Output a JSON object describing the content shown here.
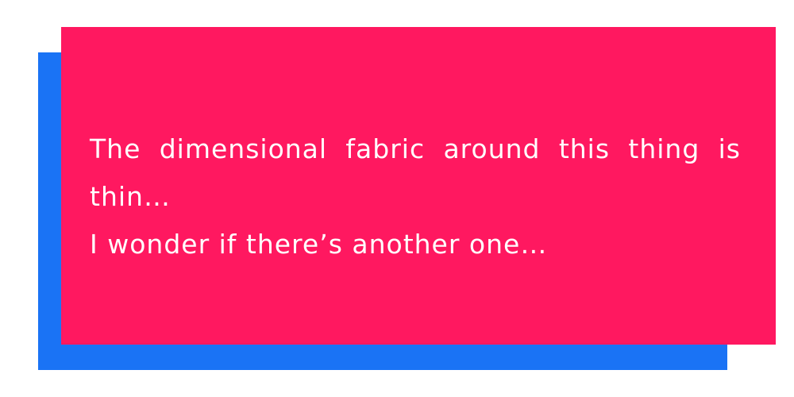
{
  "dialog": {
    "lines": [
      "The dimensional fabric around this thing is thin…",
      "I wonder if there’s another one…"
    ]
  },
  "colors": {
    "box": "#ff1860",
    "shadow": "#1a73f5",
    "text": "#ffffff",
    "background": "#ffffff"
  }
}
